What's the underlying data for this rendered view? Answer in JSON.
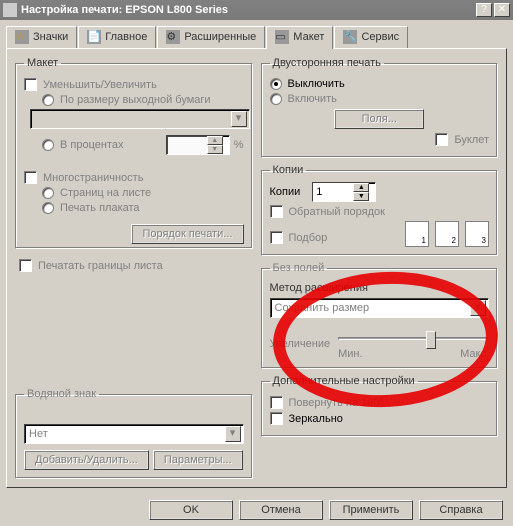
{
  "window": {
    "title": "Настройка печати: EPSON L800 Series"
  },
  "tabs": {
    "icons": "Значки",
    "main": "Главное",
    "advanced": "Расширенные",
    "layout": "Макет",
    "service": "Сервис"
  },
  "layout_group": {
    "legend": "Макет",
    "reduce_enlarge": "Уменьшить/Увеличить",
    "fit_output": "По размеру выходной бумаги",
    "percent": "В процентах",
    "percent_sign": "%",
    "multipage": "Многостраничность",
    "pages_per_sheet": "Страниц на листе",
    "poster": "Печать плаката",
    "print_order_btn": "Порядок печати...",
    "print_borders": "Печатать границы листа"
  },
  "watermark_group": {
    "legend": "Водяной знак",
    "none": "Нет",
    "add_remove_btn": "Добавить/Удалить...",
    "params_btn": "Параметры..."
  },
  "duplex_group": {
    "legend": "Двусторонняя печать",
    "off": "Выключить",
    "on": "Включить",
    "margins_btn": "Поля...",
    "booklet": "Буклет"
  },
  "copies_group": {
    "legend": "Копии",
    "copies_label": "Копии",
    "copies_value": "1",
    "reverse": "Обратный порядок",
    "collate": "Подбор",
    "p1": "1",
    "p2": "2",
    "p3": "3"
  },
  "borderless_group": {
    "legend": "Без полей",
    "method_label": "Метод расширения",
    "method_value": "Сохранить размер",
    "enlarge_label": "Увеличение",
    "min": "Мин.",
    "max": "Макс."
  },
  "extra_group": {
    "legend": "Дополнительные настройки",
    "rotate": "Повернуть на 180°",
    "mirror": "Зеркально"
  },
  "buttons": {
    "ok": "OK",
    "cancel": "Отмена",
    "apply": "Применить",
    "help": "Справка"
  }
}
